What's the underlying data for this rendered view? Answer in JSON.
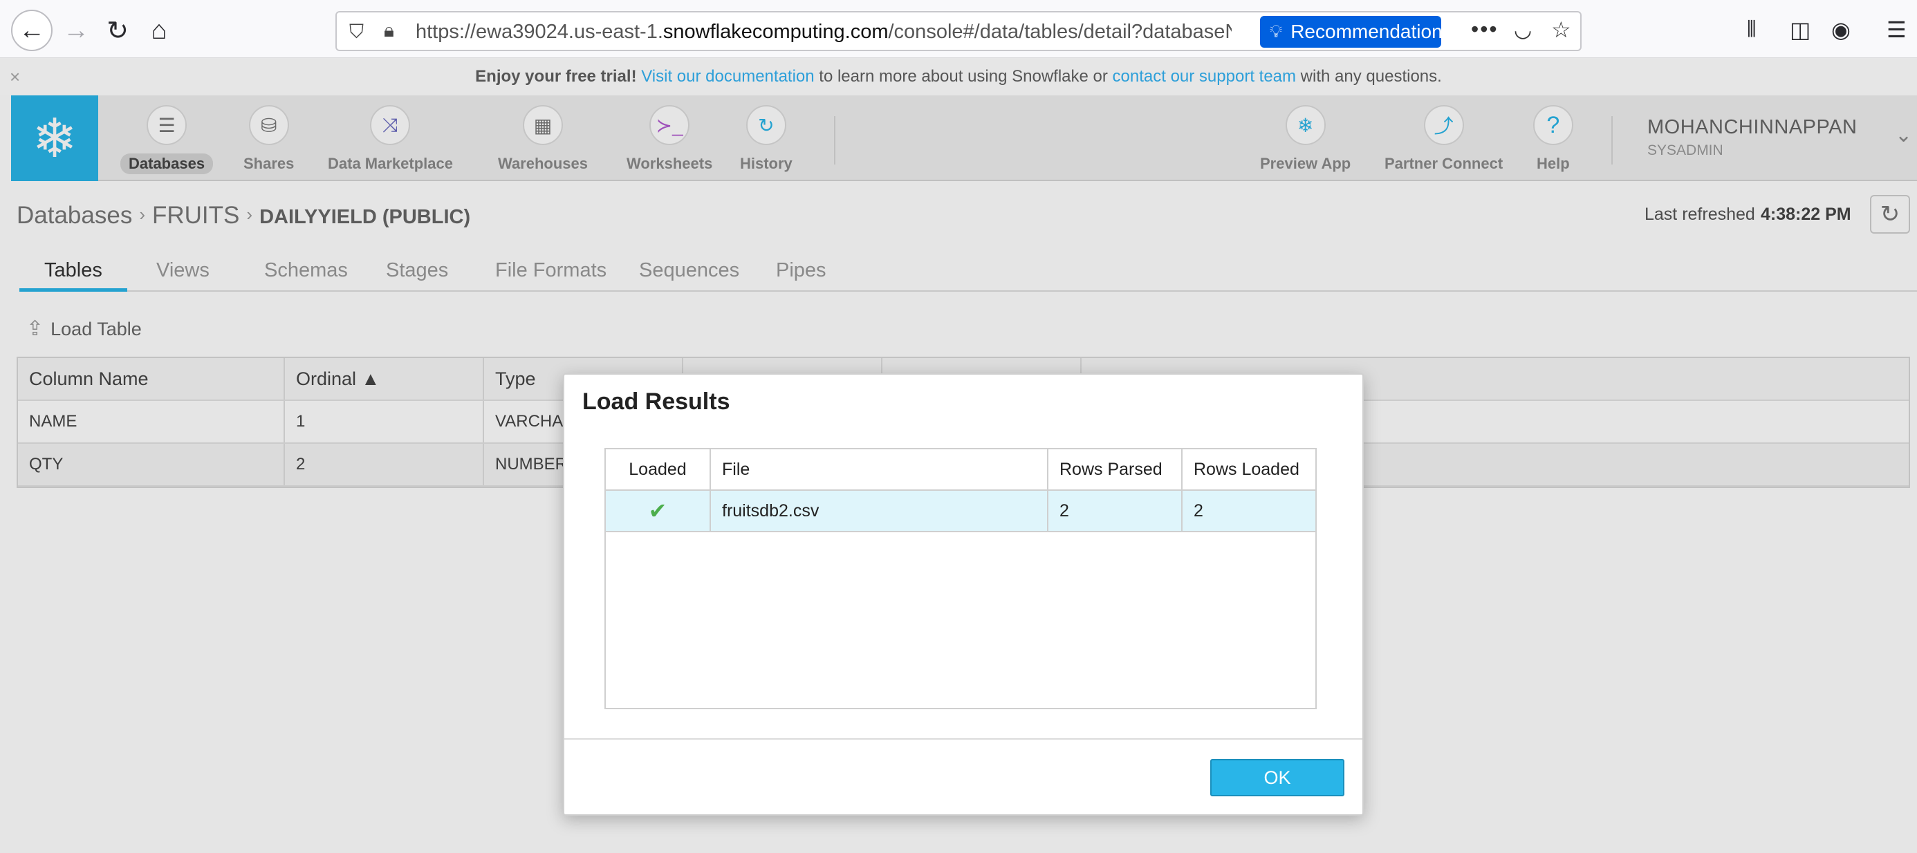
{
  "browser": {
    "url_prefix": "https://ewa39024.us-east-1.",
    "url_domain": "snowflakecomputing.com",
    "url_path": "/console#/data/tables/detail?databaseName",
    "recommendation_label": "Recommendation"
  },
  "banner": {
    "lead": "Enjoy your free trial!",
    "link1": "Visit our documentation",
    "middle": " to learn more about using Snowflake or ",
    "link2": "contact our support team",
    "tail": " with any questions.",
    "close": "×"
  },
  "nav": {
    "databases": "Databases",
    "shares": "Shares",
    "marketplace": "Data Marketplace",
    "warehouses": "Warehouses",
    "worksheets": "Worksheets",
    "history": "History",
    "preview_app": "Preview App",
    "partner_connect": "Partner Connect",
    "help": "Help"
  },
  "user": {
    "name": "MOHANCHINNAPPAN",
    "role": "SYSADMIN"
  },
  "breadcrumb": {
    "root": "Databases",
    "database": "FRUITS",
    "table": "DAILYYIELD (PUBLIC)"
  },
  "refresh": {
    "label": "Last refreshed",
    "time": "4:38:22 PM"
  },
  "tabs": [
    "Tables",
    "Views",
    "Schemas",
    "Stages",
    "File Formats",
    "Sequences",
    "Pipes"
  ],
  "toolbar": {
    "load_table": "Load Table"
  },
  "columns_grid": {
    "headers": [
      "Column Name",
      "Ordinal ▲",
      "Type"
    ],
    "rows": [
      [
        "NAME",
        "1",
        "VARCHAR"
      ],
      [
        "QTY",
        "2",
        "NUMBER"
      ]
    ]
  },
  "modal": {
    "title": "Load Results",
    "headers": [
      "Loaded",
      "File",
      "Rows Parsed",
      "Rows Loaded"
    ],
    "row": {
      "file": "fruitsdb2.csv",
      "rows_parsed": "2",
      "rows_loaded": "2"
    },
    "ok_label": "OK"
  }
}
